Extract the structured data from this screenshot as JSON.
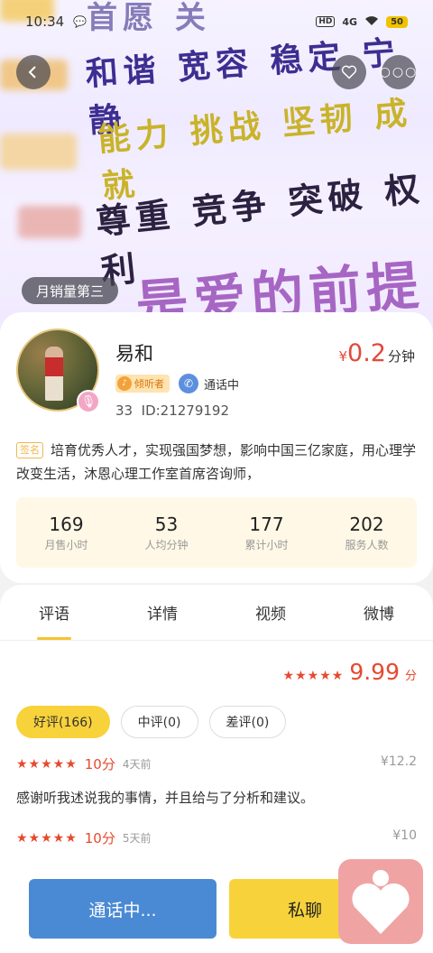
{
  "status_bar": {
    "time": "10:34",
    "hd": "HD",
    "network": "4G",
    "battery": "50"
  },
  "hero": {
    "rows": [
      "首愿 关",
      "和谐 宽容 稳定 宁静",
      "能力 挑战 坚韧 成就",
      "尊重 竞争 突破 权利",
      "是爱的前提"
    ]
  },
  "rank_tag": "月销量第三",
  "profile": {
    "name": "易和",
    "listener_tag": "倾听者",
    "call_status": "通话中",
    "level": "33",
    "id": "ID:21279192",
    "price": {
      "currency": "¥",
      "value": "0.2",
      "unit": "分钟"
    },
    "signature_label": "签名",
    "signature": "培育优秀人才，实现强国梦想，影响中国三亿家庭，用心理学改变生活，沐恩心理工作室首席咨询师，",
    "stats": [
      {
        "value": "169",
        "label": "月售小时"
      },
      {
        "value": "53",
        "label": "人均分钟"
      },
      {
        "value": "177",
        "label": "累计小时"
      },
      {
        "value": "202",
        "label": "服务人数"
      }
    ]
  },
  "tabs": [
    "评语",
    "详情",
    "视频",
    "微博"
  ],
  "rating": {
    "score": "9.99",
    "unit": "分",
    "stars": "★★★★★"
  },
  "filters": [
    "好评(166)",
    "中评(0)",
    "差评(0)"
  ],
  "reviews": [
    {
      "stars": "★★★★★",
      "score": "10分",
      "time": "4天前",
      "price": "¥12.2",
      "text": "感谢听我述说我的事情，并且给与了分析和建议。"
    },
    {
      "stars": "★★★★★",
      "score": "10分",
      "time": "5天前",
      "price": "¥10",
      "text": ""
    }
  ],
  "bottom": {
    "call_label": "通话中...",
    "message_label": "私聊"
  },
  "colors": {
    "accent_red": "#e64a2e",
    "accent_yellow": "#f8d23a",
    "call_blue": "#4a8ad4"
  }
}
